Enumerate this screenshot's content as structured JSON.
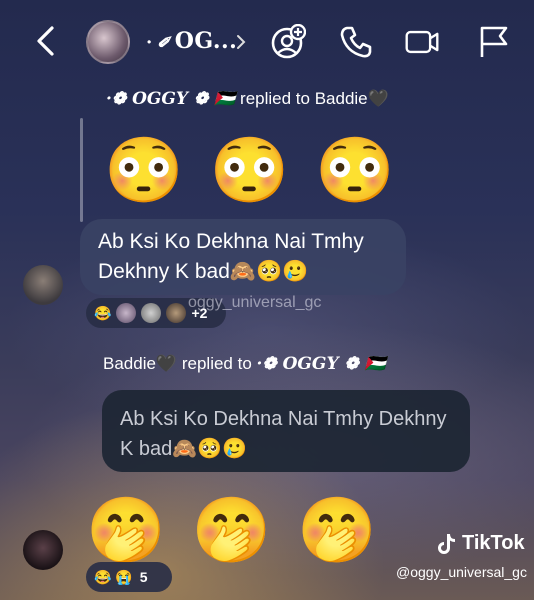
{
  "header": {
    "title": "·❁ OG...",
    "title_prefix": "·",
    "title_name": "OG...",
    "icons": [
      "back-icon",
      "add-member-icon",
      "phone-icon",
      "video-icon",
      "flag-icon"
    ]
  },
  "messages": [
    {
      "reply_header": {
        "from": "·❁ OGGY ❁ 🇵🇸",
        "text": "replied to Baddie🖤"
      },
      "content": "😳 😳 😳"
    },
    {
      "text": "Ab Ksi Ko Dekhna Nai Tmhy Dekhny K bad🙈🥺🥲",
      "reactions": {
        "emoji": "😂",
        "extra": "+2"
      }
    },
    {
      "reply_header": {
        "from": "Baddie🖤",
        "mid": "replied to",
        "to": "·❁ OGGY ❁ 🇵🇸"
      },
      "quoted_text": "Ab Ksi Ko Dekhna Nai Tmhy Dekhny K bad🙈🥺🥲"
    },
    {
      "content": "🤭 🤭 🤭",
      "reactions": {
        "emojis": "😂 😭",
        "count": "5"
      }
    }
  ],
  "watermark": "oggy_universal_gc",
  "tiktok": {
    "brand": "TikTok",
    "handle": "@oggy_universal_gc"
  }
}
